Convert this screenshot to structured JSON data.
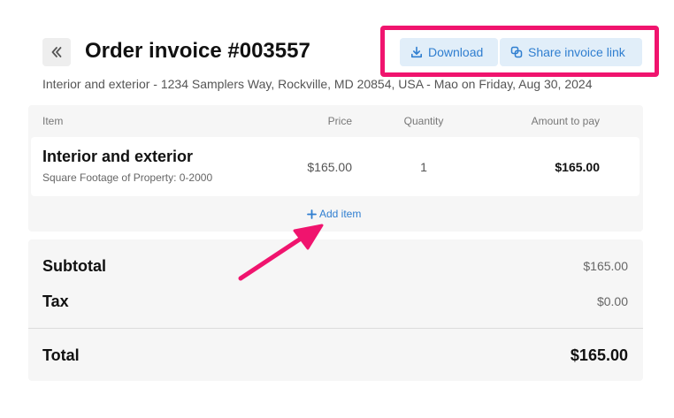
{
  "header": {
    "back_icon": "double-chevron-left-icon",
    "title": "Order invoice #003557",
    "subtitle": "Interior and exterior - 1234 Samplers Way, Rockville, MD 20854, USA - Mao on Friday, Aug 30, 2024"
  },
  "actions": {
    "download_label": "Download",
    "download_icon": "download-icon",
    "share_label": "Share invoice link",
    "share_icon": "link-copy-icon"
  },
  "table": {
    "columns": {
      "item": "Item",
      "price": "Price",
      "quantity": "Quantity",
      "amount": "Amount to pay"
    },
    "rows": [
      {
        "name": "Interior and exterior",
        "description": "Square Footage of Property: 0-2000",
        "price": "$165.00",
        "quantity": "1",
        "amount": "$165.00"
      }
    ],
    "add_item_label": "Add item"
  },
  "summary": {
    "subtotal_label": "Subtotal",
    "subtotal_value": "$165.00",
    "tax_label": "Tax",
    "tax_value": "$0.00",
    "total_label": "Total",
    "total_value": "$165.00"
  },
  "colors": {
    "accent": "#2f7ed0",
    "highlight": "#f0146e",
    "button_bg": "#e1eef9",
    "card_bg": "#f6f6f6"
  }
}
